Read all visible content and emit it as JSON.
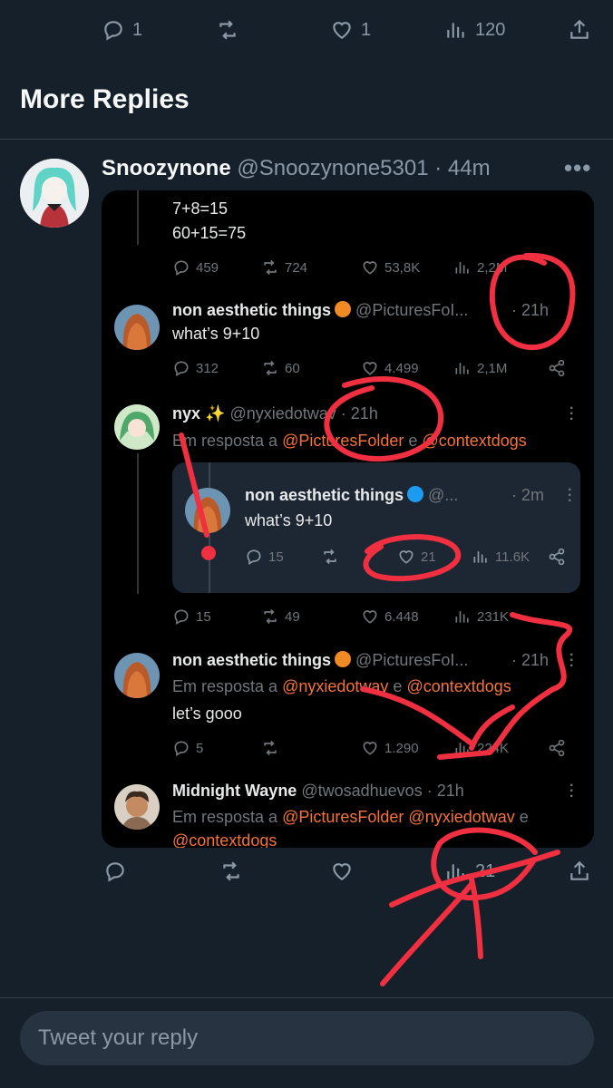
{
  "top_actions": {
    "replies": "1",
    "retweets": "",
    "likes": "1",
    "views": "120"
  },
  "section_title": "More Replies",
  "reply": {
    "name": "Snoozynone",
    "meta": "@Snoozynone5301 · 44m"
  },
  "embed": {
    "line1": "7+8=15",
    "line2": "60+15=75",
    "t0_actions": {
      "replies": "459",
      "retweets": "724",
      "likes": "53,8K",
      "views": "2,2M"
    },
    "t1": {
      "name": "non aesthetic things",
      "handle": "@PicturesFoI...",
      "time": "· 21h",
      "text": "what’s 9+10"
    },
    "t1_actions": {
      "replies": "312",
      "retweets": "60",
      "likes": "4.499",
      "views": "2,1M"
    },
    "t2": {
      "name": "nyx ✨",
      "handle": "@nyxiedotwav",
      "time": "· 21h",
      "reply_prefix": "Em resposta a",
      "mention1": "@PicturesFolder",
      "conj": "e",
      "mention2": "@contextdogs"
    },
    "quote": {
      "name": "non aesthetic things",
      "handle": "@...",
      "time": "· 2m",
      "text": "what’s 9+10",
      "replies": "15",
      "likes": "21",
      "views": "11.6K"
    },
    "t2_actions": {
      "replies": "15",
      "retweets": "49",
      "likes": "6.448",
      "views": "231K"
    },
    "t3": {
      "name": "non aesthetic things",
      "handle": "@PicturesFoI...",
      "time": "· 21h",
      "reply_prefix": "Em resposta a",
      "mention1": "@nyxiedotwav",
      "conj": "e",
      "mention2": "@contextdogs",
      "text": "let’s gooo"
    },
    "t3_actions": {
      "replies": "5",
      "likes": "1.290",
      "views": "224K"
    },
    "t4": {
      "name": "Midnight Wayne",
      "handle": "@twosadhuevos",
      "time": "· 21h",
      "reply_prefix": "Em resposta a",
      "mention1": "@PicturesFolder",
      "mention2": "@nyxiedotwav",
      "conj": "e",
      "mention3": "@contextdogs"
    }
  },
  "bottom_actions": {
    "views": "21"
  },
  "reply_box": {
    "placeholder": "Tweet your reply"
  },
  "colors": {
    "background": "#15202b",
    "embed_bg": "#000000",
    "link": "#f4733b",
    "annotation": "#f03040",
    "verified_gold": "#f08a24",
    "verified_blue": "#1d9bf0"
  },
  "icons": [
    "reply-icon",
    "retweet-icon",
    "like-icon",
    "views-icon",
    "share-icon",
    "more-icon",
    "verified-badge-icon"
  ]
}
